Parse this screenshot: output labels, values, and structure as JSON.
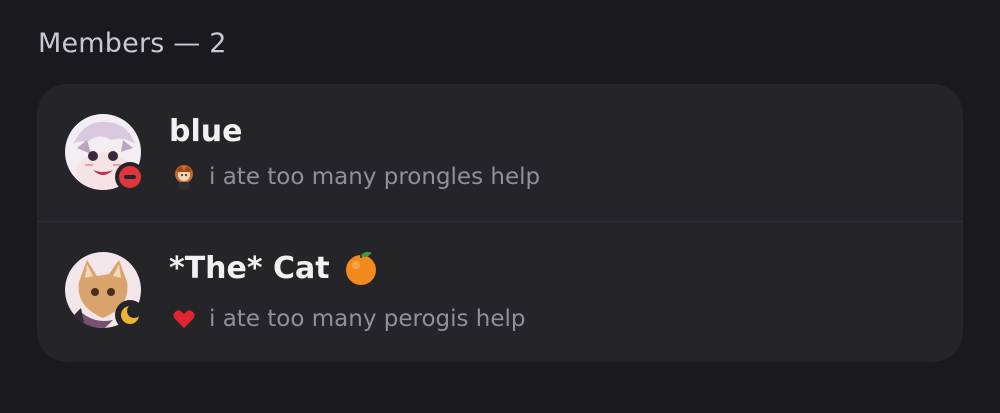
{
  "section": {
    "title": "Members — 2"
  },
  "members": [
    {
      "name": "blue",
      "status_text": "i ate too many prongles help",
      "presence": "do-not-disturb",
      "status_emoji": "chibi-character-icon",
      "name_emoji": ""
    },
    {
      "name": "*The* Cat",
      "status_text": "i ate too many perogis help",
      "presence": "idle",
      "status_emoji": "red-heart-icon",
      "name_emoji": "orange-fruit-icon"
    }
  ],
  "colors": {
    "background": "#1a1a1e",
    "card": "#242429",
    "dnd": "#e0353d",
    "idle": "#f0b232",
    "heart": "#e0242b"
  }
}
